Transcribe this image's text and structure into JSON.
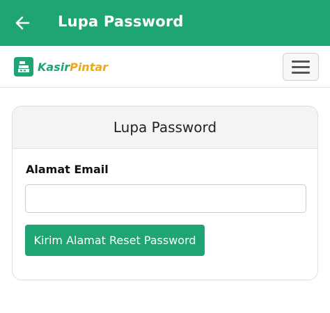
{
  "appbar": {
    "title": "Lupa Password",
    "back_icon": "arrow-left-icon"
  },
  "navbar": {
    "brand": {
      "part1": "Kasir",
      "part2": "Pintar",
      "logo_icon": "cash-register-icon"
    },
    "toggle_icon": "hamburger-menu-icon"
  },
  "card": {
    "title": "Lupa Password",
    "email_label": "Alamat Email",
    "email_value": "",
    "email_placeholder": "",
    "submit_label": "Kirim Alamat Reset Password"
  },
  "colors": {
    "primary": "#1fa574",
    "brand_accent": "#f0a818"
  }
}
